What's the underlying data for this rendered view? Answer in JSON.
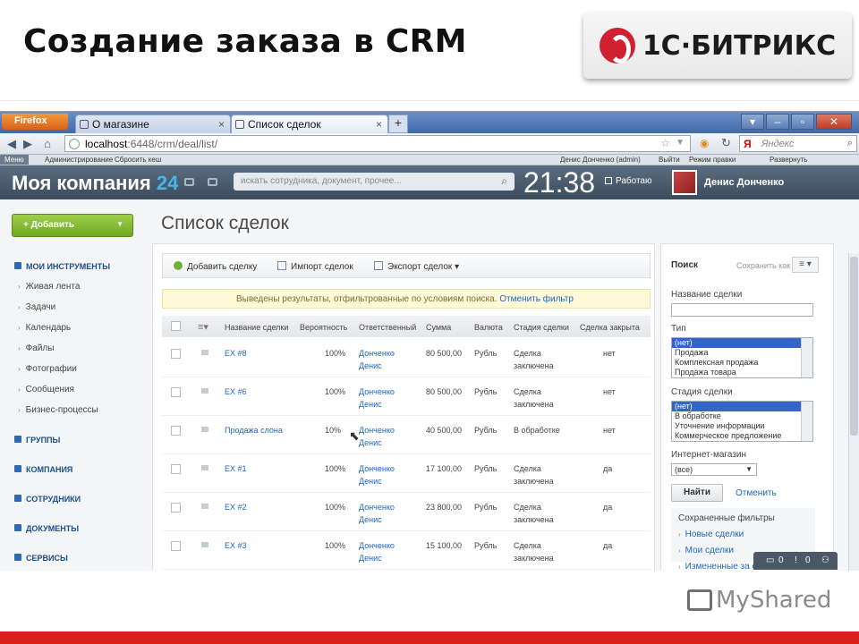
{
  "slide": {
    "title": "Создание заказа в CRM",
    "logo_text": "1С·БИТРИКС",
    "watermark": "MyShared"
  },
  "browser": {
    "firefox_label": "Firefox",
    "tabs": [
      {
        "label": "О магазине",
        "active": false
      },
      {
        "label": "Список сделок",
        "active": true
      }
    ],
    "new_tab": "+",
    "url_host": "localhost",
    "url_rest": ":6448/crm/deal/list/",
    "search_engine": "Я",
    "search_placeholder": "Яндекс"
  },
  "admin_bar": {
    "menu": "Меню",
    "items": [
      "Администрирование",
      "Сбросить кеш",
      "Денис Донченко (admin)",
      "Выйти",
      "Режим правки",
      "Развернуть"
    ]
  },
  "portal": {
    "company_name": "Моя компания",
    "company_num": "24",
    "search_placeholder": "искать сотрудника, документ, прочее...",
    "clock": "21:38",
    "working_label": "Работаю",
    "user_name": "Денис Донченко"
  },
  "sidebar": {
    "add_button": "Добавить",
    "sections": [
      {
        "label": "МОИ ИНСТРУМЕНТЫ"
      },
      {
        "label": "ГРУППЫ"
      },
      {
        "label": "КОМПАНИЯ"
      },
      {
        "label": "СОТРУДНИКИ"
      },
      {
        "label": "ДОКУМЕНТЫ"
      },
      {
        "label": "СЕРВИСЫ"
      }
    ],
    "tools": [
      "Живая лента",
      "Задачи",
      "Календарь",
      "Файлы",
      "Фотографии",
      "Сообщения",
      "Бизнес-процессы"
    ]
  },
  "main": {
    "page_title": "Список сделок",
    "toolbar": {
      "add_deal": "Добавить сделку",
      "import": "Импорт сделок",
      "export": "Экспорт сделок"
    },
    "banner": {
      "text": "Выведены результаты, отфильтрованные по условиям поиска.",
      "cancel_link": "Отменить фильтр"
    },
    "columns": [
      "Название сделки",
      "Вероятность",
      "Ответственный",
      "Сумма",
      "Валюта",
      "Стадия сделки",
      "Сделка закрыта"
    ],
    "rows": [
      {
        "name": "EX #8",
        "prob": "100%",
        "resp1": "Донченко",
        "resp2": "Денис",
        "sum": "80 500,00",
        "cur": "Рубль",
        "stage1": "Сделка",
        "stage2": "заключена",
        "closed": "нет"
      },
      {
        "name": "EX #6",
        "prob": "100%",
        "resp1": "Донченко",
        "resp2": "Денис",
        "sum": "80 500,00",
        "cur": "Рубль",
        "stage1": "Сделка",
        "stage2": "заключена",
        "closed": "нет"
      },
      {
        "name": "Продажа слона",
        "prob": "10%",
        "resp1": "Донченко",
        "resp2": "Денис",
        "sum": "40 500,00",
        "cur": "Рубль",
        "stage1": "В обработке",
        "stage2": "",
        "closed": "нет"
      },
      {
        "name": "EX #1",
        "prob": "100%",
        "resp1": "Донченко",
        "resp2": "Денис",
        "sum": "17 100,00",
        "cur": "Рубль",
        "stage1": "Сделка",
        "stage2": "заключена",
        "closed": "да"
      },
      {
        "name": "EX #2",
        "prob": "100%",
        "resp1": "Донченко",
        "resp2": "Денис",
        "sum": "23 800,00",
        "cur": "Рубль",
        "stage1": "Сделка",
        "stage2": "заключена",
        "closed": "да"
      },
      {
        "name": "EX #3",
        "prob": "100%",
        "resp1": "Донченко",
        "resp2": "Денис",
        "sum": "15 100,00",
        "cur": "Рубль",
        "stage1": "Сделка",
        "stage2": "заключена",
        "closed": "да"
      }
    ]
  },
  "filter": {
    "title": "Поиск",
    "save_as": "Сохранить как",
    "deal_name_label": "Название сделки",
    "type_label": "Тип",
    "type_options": [
      "(нет)",
      "Продажа",
      "Комплексная продажа",
      "Продажа товара"
    ],
    "stage_label": "Стадия сделки",
    "stage_options": [
      "(нет)",
      "В обработке",
      "Уточнение информации",
      "Коммерческое предложение"
    ],
    "shop_label": "Интернет-магазин",
    "shop_value": "(все)",
    "find_button": "Найти",
    "cancel_button": "Отменить",
    "saved_title": "Сохраненные фильтры",
    "saved_items": [
      "Новые сделки",
      "Мои сделки",
      "Измененные за се"
    ]
  },
  "chat": {
    "count1": "0",
    "count2": "0"
  }
}
